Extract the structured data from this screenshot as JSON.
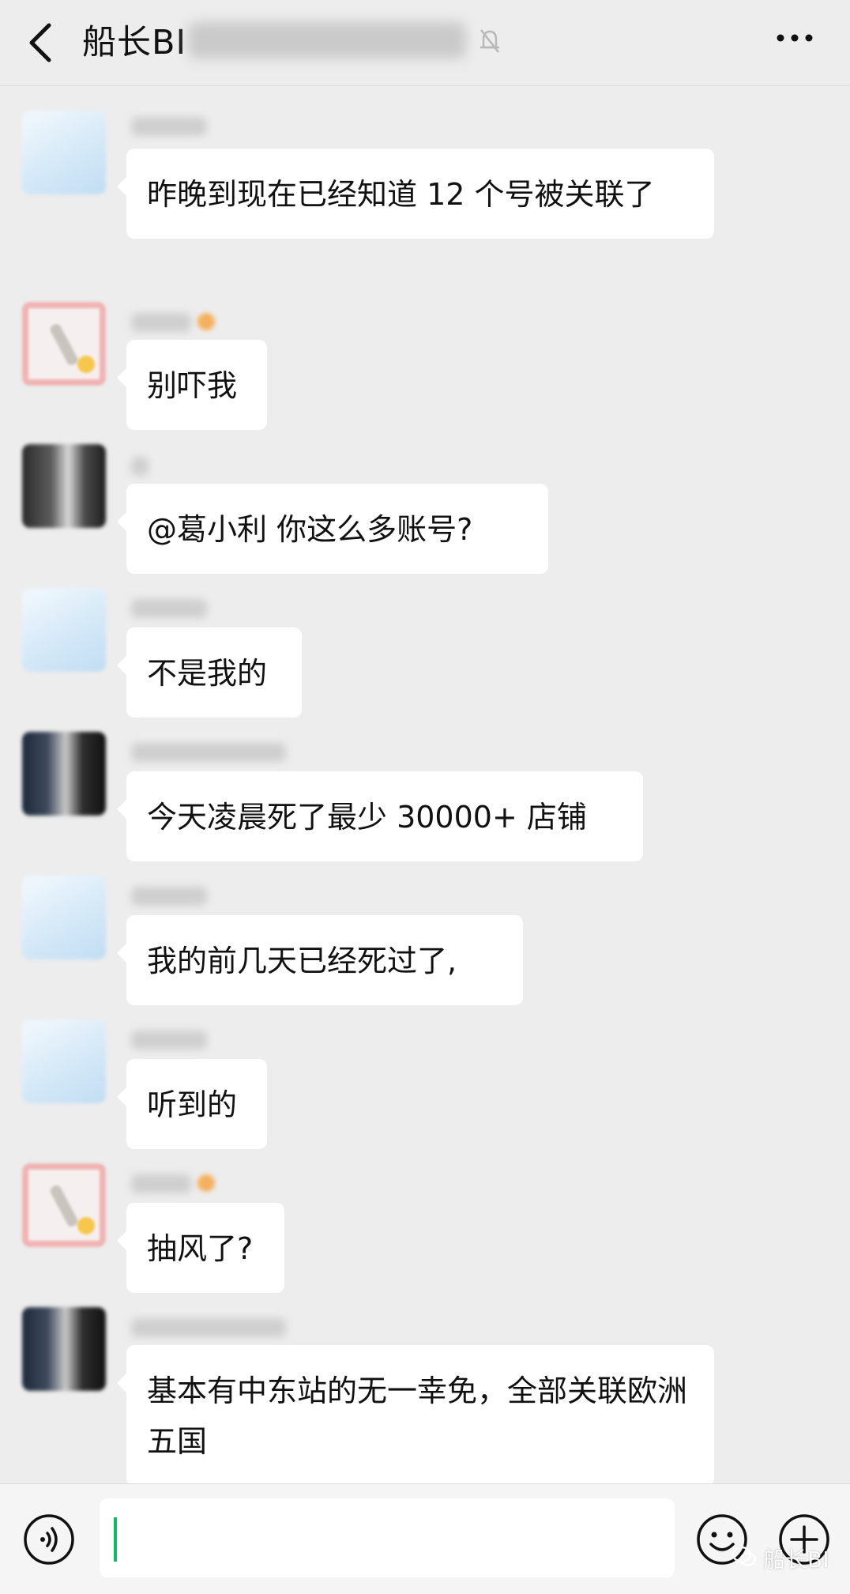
{
  "header": {
    "title": "船长BI",
    "back_icon": "chevron-left-icon",
    "mute_icon": "bell-off-icon",
    "more_icon": "more-dots-icon"
  },
  "messages": [
    {
      "text": "昨晚到现在已经知道 12 个号被关联了"
    },
    {
      "text": "别吓我"
    },
    {
      "text": "@葛小利  你这么多账号?"
    },
    {
      "text": "不是我的"
    },
    {
      "text": "今天凌晨死了最少 30000+ 店铺"
    },
    {
      "text": "我的前几天已经死过了,"
    },
    {
      "text": "听到的"
    },
    {
      "text": "抽风了?"
    },
    {
      "text": "基本有中东站的无一幸免，全部关联欧洲五国"
    }
  ],
  "input_bar": {
    "voice_icon": "voice-icon",
    "emoji_icon": "emoji-icon",
    "plus_icon": "plus-circle-icon",
    "input_value": ""
  },
  "watermark": {
    "text": "船长BI"
  },
  "colors": {
    "background": "#ededed",
    "bubble": "#ffffff",
    "cursor": "#07c160"
  }
}
